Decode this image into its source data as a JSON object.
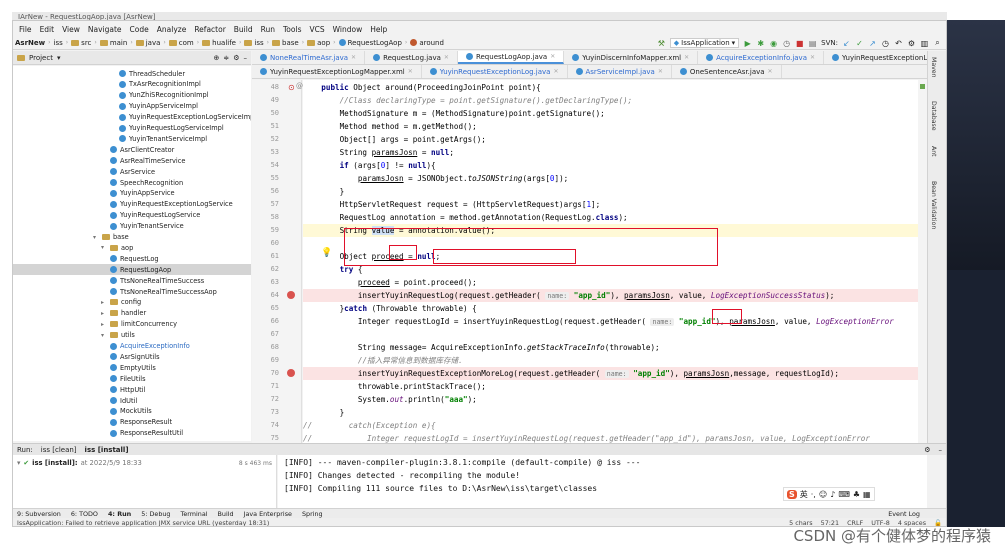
{
  "titlebar": {
    "text": "IArNew - RequestLogAop.java [AsrNew]"
  },
  "menu": [
    "File",
    "Edit",
    "View",
    "Navigate",
    "Code",
    "Analyze",
    "Refactor",
    "Build",
    "Run",
    "Tools",
    "VCS",
    "Window",
    "Help"
  ],
  "breadcrumb": [
    "AsrNew",
    "iss",
    "src",
    "main",
    "java",
    "com",
    "hualife",
    "iss",
    "base",
    "aop",
    "RequestLogAop",
    "around"
  ],
  "toolbar": {
    "run_config": "IssApplication",
    "svn_label": "SVN:"
  },
  "project_panel": {
    "title": "Project"
  },
  "tree": [
    {
      "label": "ThreadScheduler",
      "type": "class",
      "indent": 3
    },
    {
      "label": "TxAsrRecognitionImpl",
      "type": "class",
      "indent": 3
    },
    {
      "label": "YunZhiSRecognitionImpl",
      "type": "class",
      "indent": 3
    },
    {
      "label": "YuyinAppServiceImpl",
      "type": "class",
      "indent": 3
    },
    {
      "label": "YuyinRequestExceptionLogServiceImpl",
      "type": "class",
      "indent": 3
    },
    {
      "label": "YuyinRequestLogServiceImpl",
      "type": "class",
      "indent": 3
    },
    {
      "label": "YuyinTenantServiceImpl",
      "type": "class",
      "indent": 3
    },
    {
      "label": "AsrClientCreator",
      "type": "class",
      "indent": 2
    },
    {
      "label": "AsrRealTimeService",
      "type": "class",
      "indent": 2
    },
    {
      "label": "AsrService",
      "type": "class",
      "indent": 2
    },
    {
      "label": "SpeechRecognition",
      "type": "class",
      "indent": 2
    },
    {
      "label": "YuyinAppService",
      "type": "class",
      "indent": 2
    },
    {
      "label": "YuyinRequestExceptionLogService",
      "type": "class",
      "indent": 2
    },
    {
      "label": "YuyinRequestLogService",
      "type": "class",
      "indent": 2
    },
    {
      "label": "YuyinTenantService",
      "type": "class",
      "indent": 2
    },
    {
      "label": "base",
      "type": "folder",
      "indent": 0,
      "open": true
    },
    {
      "label": "aop",
      "type": "folder",
      "indent": 1,
      "open": true
    },
    {
      "label": "RequestLog",
      "type": "class",
      "indent": 2
    },
    {
      "label": "RequestLogAop",
      "type": "class",
      "indent": 2,
      "selected": true
    },
    {
      "label": "TtsNoneRealTimeSuccess",
      "type": "class",
      "indent": 2
    },
    {
      "label": "TtsNoneRealTimeSuccessAop",
      "type": "class",
      "indent": 2
    },
    {
      "label": "config",
      "type": "folder",
      "indent": 1
    },
    {
      "label": "handler",
      "type": "folder",
      "indent": 1
    },
    {
      "label": "limitConcurrency",
      "type": "folder",
      "indent": 1
    },
    {
      "label": "utils",
      "type": "folder",
      "indent": 1,
      "open": true
    },
    {
      "label": "AcquireExceptionInfo",
      "type": "class",
      "indent": 2,
      "highlight": true
    },
    {
      "label": "AsrSignUtils",
      "type": "class",
      "indent": 2
    },
    {
      "label": "EmptyUtils",
      "type": "class",
      "indent": 2
    },
    {
      "label": "FileUtils",
      "type": "class",
      "indent": 2
    },
    {
      "label": "HttpUtil",
      "type": "class",
      "indent": 2
    },
    {
      "label": "IdUtil",
      "type": "class",
      "indent": 2
    },
    {
      "label": "MockUtils",
      "type": "class",
      "indent": 2
    },
    {
      "label": "ResponseResult",
      "type": "class",
      "indent": 2
    },
    {
      "label": "ResponseResultUtil",
      "type": "class",
      "indent": 2
    }
  ],
  "tabs_row1": [
    {
      "label": "NoneRealTimeAsr.java",
      "blue": true
    },
    {
      "label": "RequestLog.java"
    },
    {
      "label": "RequestLogAop.java",
      "active": true
    },
    {
      "label": "YuyinDiscernInfoMapper.xml"
    },
    {
      "label": "AcquireExceptionInfo.java",
      "blue": true
    },
    {
      "label": "YuyinRequestExceptionLogMapper.java"
    }
  ],
  "tabs_row2": [
    {
      "label": "YuyinRequestExceptionLogMapper.xml"
    },
    {
      "label": "YuyinRequestExceptionLog.java",
      "blue": true
    },
    {
      "label": "AsrServiceImpl.java",
      "blue": true
    },
    {
      "label": "OneSentenceAsr.java"
    }
  ],
  "code": {
    "lines": [
      {
        "no": "48",
        "html": "    <span class=\"kw\">public</span> Object around(ProceedingJoinPoint point){"
      },
      {
        "no": "49",
        "html": "        <span class=\"cm\">//Class declaringType = point.getSignature().getDeclaringType();</span>"
      },
      {
        "no": "50",
        "html": "        MethodSignature m = (MethodSignature)point.getSignature();"
      },
      {
        "no": "51",
        "html": "        Method method = m.getMethod();"
      },
      {
        "no": "52",
        "html": "        Object[] args = point.getArgs();"
      },
      {
        "no": "53",
        "html": "        String <span class=\"und\">paramsJosn</span> = <span class=\"kw\">null</span>;"
      },
      {
        "no": "54",
        "html": "        <span class=\"kw\">if</span> (args[<span style=\"color:#0000ff\">0</span>] != <span class=\"kw\">null</span>){"
      },
      {
        "no": "55",
        "html": "            <span class=\"und\">paramsJosn</span> = JSONObject.<span class=\"it\">toJSONString</span>(args[<span style=\"color:#0000ff\">0</span>]);"
      },
      {
        "no": "56",
        "html": "        }"
      },
      {
        "no": "57",
        "html": "        HttpServletRequest request = (HttpServletRequest)args[<span style=\"color:#0000ff\">1</span>];"
      },
      {
        "no": "58",
        "html": "        RequestLog annotation = method.getAnnotation(RequestLog.<span class=\"kw\">class</span>);"
      },
      {
        "no": "59",
        "html": "        String <span style=\"background:#cfe0f5\">value</span> = annotation.value();"
      },
      {
        "no": "60",
        "html": ""
      },
      {
        "no": "61",
        "html": "        Object <span class=\"und\">proceed</span> = <span class=\"kw\">null</span>;"
      },
      {
        "no": "62",
        "html": "        <span class=\"kw\">try</span> {"
      },
      {
        "no": "63",
        "html": "            <span class=\"und\">proceed</span> = point.proceed();"
      },
      {
        "no": "64",
        "html": "            insertYuyinRequestLog(request.getHeader( <span class=\"hint\">name:</span> <span class=\"st\">\"app_id\"</span>), <span class=\"und\">paramsJosn</span>, value, <span class=\"fld it\">LogExceptionSuccessStatus</span>);"
      },
      {
        "no": "65",
        "html": "        }<span class=\"kw\">catch</span> (Throwable throwable) {"
      },
      {
        "no": "66",
        "html": "            Integer requestLogId = insertYuyinRequestLog(request.getHeader( <span class=\"hint\">name:</span> <span class=\"st\">\"app_id\"</span>), <span class=\"und\">paramsJosn</span>, value, <span class=\"fld it\">LogExceptionError</span>"
      },
      {
        "no": "67",
        "html": ""
      },
      {
        "no": "68",
        "html": "            String message= AcquireExceptionInfo.<span class=\"it\">getStackTraceInfo</span>(throwable);"
      },
      {
        "no": "69",
        "html": "            <span class=\"cm\">//插入异常信息到数据库存储.</span>"
      },
      {
        "no": "70",
        "html": "            insertYuyinRequestExceptionMoreLog(request.getHeader( <span class=\"hint\">name:</span> <span class=\"st\">\"app_id\"</span>), <span class=\"und\">paramsJosn</span>,message, requestLogId);"
      },
      {
        "no": "71",
        "html": "            throwable.printStackTrace();"
      },
      {
        "no": "72",
        "html": "            System.<span class=\"fld it\">out</span>.println(<span class=\"st\">\"aaa\"</span>);"
      },
      {
        "no": "73",
        "html": "        }"
      },
      {
        "no": "74",
        "html": "<span class=\"cm\">//        catch(Exception e){</span>"
      },
      {
        "no": "75",
        "html": "<span class=\"cm\">//            Integer requestLogId = insertYuyinRequestLog(request.getHeader(\"app_id\"), paramsJosn, value, LogExceptionError</span>"
      }
    ]
  },
  "right_strip": [
    "Maven",
    "Database",
    "Ant",
    "Bean Validation"
  ],
  "run_panel": {
    "tabs": [
      "Run:",
      "iss [clean]",
      "iss [install]"
    ],
    "item_label": "iss [install]:",
    "item_detail": "at 2022/5/9 18:33",
    "item_time": "8 s 463 ms"
  },
  "console": [
    "[INFO] --- maven-compiler-plugin:3.8.1:compile (default-compile) @ iss ---",
    "[INFO] Changes detected - recompiling the module!",
    "[INFO] Compiling 111 source files to D:\\AsrNew\\iss\\target\\classes"
  ],
  "bottom_tools": [
    "9: Subversion",
    "6: TODO",
    "4: Run",
    "5: Debug",
    "Terminal",
    "Build",
    "Java Enterprise",
    "Spring"
  ],
  "event_log": "Event Log",
  "status": {
    "message": "IssApplication: Failed to retrieve application JMX service URL (yesterday 18:31)",
    "chars": "5 chars",
    "pos": "57:21",
    "crlf": "CRLF",
    "enc": "UTF-8",
    "indent": "4 spaces"
  },
  "ime": {
    "logo": "S",
    "mode": "英"
  },
  "watermark": "CSDN @有个健体梦的程序猿",
  "colors": {
    "accent": "#4a90d9",
    "box": "#e0102a",
    "class_icon": "#3d8fd1",
    "folder_icon": "#c9a449"
  }
}
